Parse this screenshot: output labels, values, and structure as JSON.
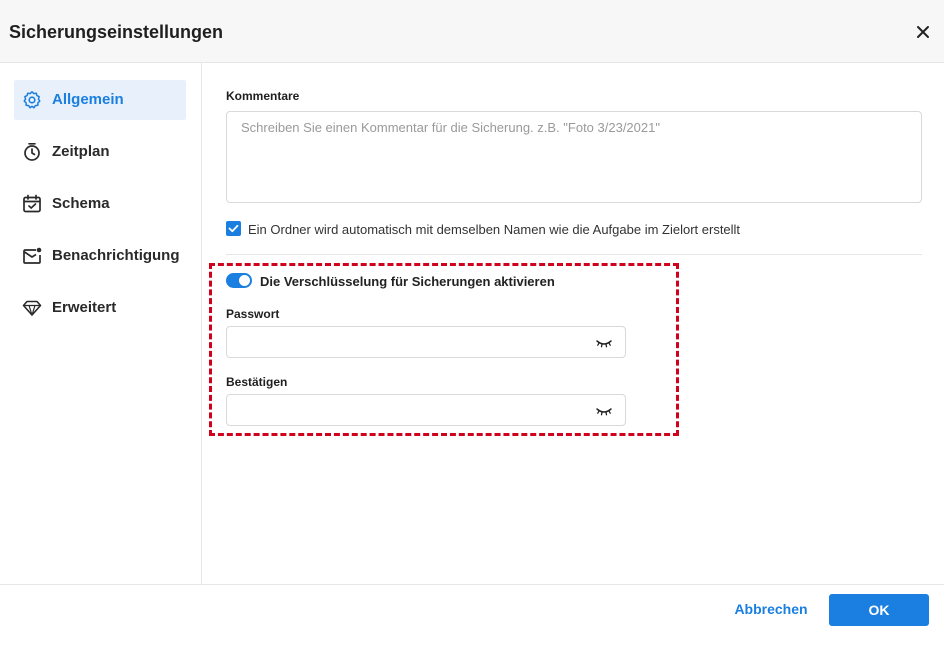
{
  "dialog": {
    "title": "Sicherungseinstellungen",
    "close_icon": "close-icon"
  },
  "sidebar": {
    "items": [
      {
        "label": "Allgemein",
        "icon": "gear-icon",
        "active": true
      },
      {
        "label": "Zeitplan",
        "icon": "stopwatch-icon",
        "active": false
      },
      {
        "label": "Schema",
        "icon": "calendar-check-icon",
        "active": false
      },
      {
        "label": "Benachrichtigung",
        "icon": "mail-notification-icon",
        "active": false
      },
      {
        "label": "Erweitert",
        "icon": "diamond-icon",
        "active": false
      }
    ]
  },
  "general": {
    "comments_label": "Kommentare",
    "comments_value": "",
    "comments_placeholder": "Schreiben Sie einen Kommentar für die Sicherung. z.B. \"Foto 3/23/2021\"",
    "auto_folder_checked": true,
    "auto_folder_label": "Ein Ordner wird automatisch mit demselben Namen wie die Aufgabe im Zielort erstellt",
    "encryption": {
      "enabled": true,
      "toggle_label": "Die Verschlüsselung für Sicherungen aktivieren",
      "password_label": "Passwort",
      "password_value": "",
      "confirm_label": "Bestätigen",
      "confirm_value": "",
      "visibility_icon": "eye-closed-icon"
    }
  },
  "footer": {
    "cancel_label": "Abbrechen",
    "ok_label": "OK"
  },
  "colors": {
    "accent": "#1a7fe0",
    "active_bg": "#e8f1fb",
    "highlight_border": "#d0021b"
  }
}
